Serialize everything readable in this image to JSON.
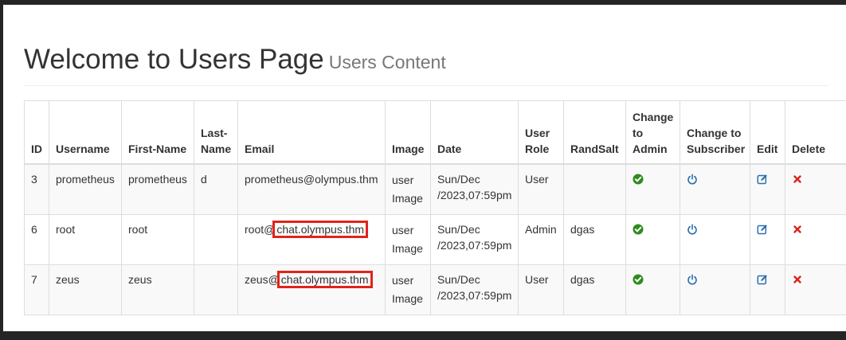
{
  "header": {
    "title": "Welcome to Users Page",
    "subtitle": "Users Content"
  },
  "table": {
    "columns": [
      "ID",
      "Username",
      "First-Name",
      "Last-Name",
      "Email",
      "Image",
      "Date",
      "User Role",
      "RandSalt",
      "Change to Admin",
      "Change to Subscriber",
      "Edit",
      "Delete"
    ],
    "rows": [
      {
        "id": "3",
        "username": "prometheus",
        "firstname": "prometheus",
        "lastname": "d",
        "email_user": "prometheus@olympus.thm",
        "email_domain": "",
        "image_1": "user",
        "image_2": "Image",
        "date_1": "Sun/Dec",
        "date_2": "/2023,07:59pm",
        "role": "User",
        "randsalt": ""
      },
      {
        "id": "6",
        "username": "root",
        "firstname": "root",
        "lastname": "",
        "email_user": "root@",
        "email_domain": "chat.olympus.thm",
        "image_1": "user",
        "image_2": "Image",
        "date_1": "Sun/Dec",
        "date_2": "/2023,07:59pm",
        "role": "Admin",
        "randsalt": "dgas"
      },
      {
        "id": "7",
        "username": "zeus",
        "firstname": "zeus",
        "lastname": "",
        "email_user": "zeus@",
        "email_domain": "chat.olympus.thm",
        "image_1": "user",
        "image_2": "Image",
        "date_1": "Sun/Dec",
        "date_2": "/2023,07:59pm",
        "role": "User",
        "randsalt": "dgas"
      }
    ]
  },
  "colors": {
    "admin": "#2e8b1f",
    "subscriber": "#2a6fb0",
    "edit": "#2a6fb0",
    "delete": "#d9241c",
    "highlight": "#e2231a"
  },
  "icons": {
    "admin": "check-circle-icon",
    "subscriber": "power-icon",
    "edit": "edit-icon",
    "delete": "delete-icon"
  }
}
